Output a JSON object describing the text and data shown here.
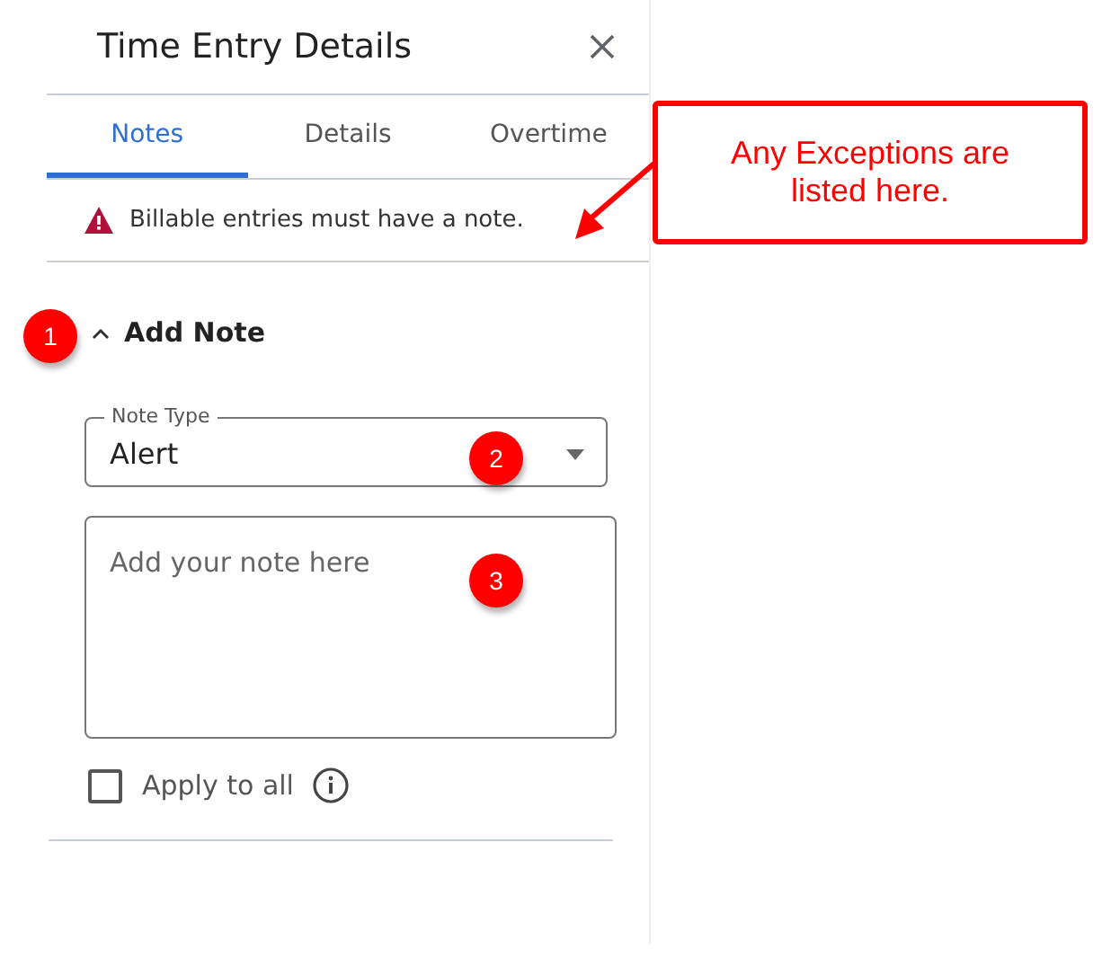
{
  "panel": {
    "title": "Time Entry Details"
  },
  "tabs": [
    {
      "label": "Notes",
      "selected": true
    },
    {
      "label": "Details",
      "selected": false
    },
    {
      "label": "Overtime",
      "selected": false
    }
  ],
  "exception": {
    "text": "Billable entries must have a note."
  },
  "section": {
    "title": "Add Note",
    "expanded": true
  },
  "note_type": {
    "label": "Note Type",
    "value": "Alert"
  },
  "note": {
    "placeholder": "Add your note here"
  },
  "apply_to_all": {
    "label": "Apply to all",
    "checked": false
  },
  "callout": {
    "text": "Any Exceptions are listed here."
  },
  "markers": [
    "1",
    "2",
    "3"
  ]
}
